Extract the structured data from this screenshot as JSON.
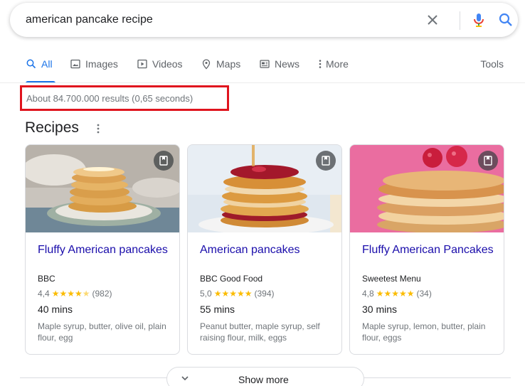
{
  "search": {
    "query": "american pancake recipe"
  },
  "tabs": [
    {
      "label": "All",
      "icon": "search-icon"
    },
    {
      "label": "Images",
      "icon": "image-icon"
    },
    {
      "label": "Videos",
      "icon": "play-icon"
    },
    {
      "label": "Maps",
      "icon": "map-pin-icon"
    },
    {
      "label": "News",
      "icon": "newspaper-icon"
    },
    {
      "label": "More",
      "icon": "more-vert-icon"
    }
  ],
  "tools_label": "Tools",
  "result_stats": "About 84.700.000 results (0,65 seconds)",
  "recipes_title": "Recipes",
  "cards": [
    {
      "title": "Fluffy American pancakes",
      "source": "BBC",
      "rating": "4,4",
      "stars": "★★★★",
      "half_star": "★",
      "reviews": "(982)",
      "time": "40 mins",
      "ingredients": "Maple syrup, butter, olive oil, plain flour, egg"
    },
    {
      "title": "American pancakes",
      "source": "BBC Good Food",
      "rating": "5,0",
      "stars": "★★★★★",
      "half_star": "",
      "reviews": "(394)",
      "time": "55 mins",
      "ingredients": "Peanut butter, maple syrup, self raising flour, milk, eggs"
    },
    {
      "title": "Fluffy American Pancakes",
      "source": "Sweetest Menu",
      "rating": "4,8",
      "stars": "★★★★★",
      "half_star": "",
      "reviews": "(34)",
      "time": "30 mins",
      "ingredients": "Maple syrup, lemon, butter, plain flour, eggs"
    }
  ],
  "show_more_label": "Show more",
  "colors": {
    "link": "#1a0dab",
    "accent": "#1a73e8",
    "star": "#fbbc04",
    "highlight_box": "#e0141e"
  }
}
